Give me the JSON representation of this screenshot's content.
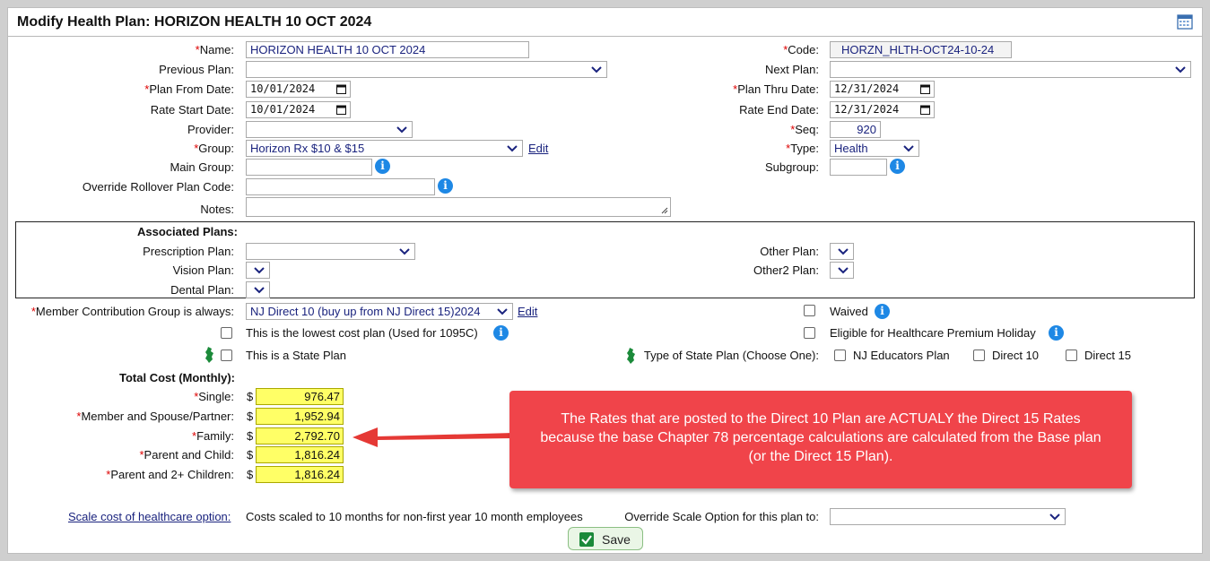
{
  "title": "Modify Health Plan: HORIZON HEALTH 10 OCT 2024",
  "form": {
    "name_label": "Name:",
    "name_value": "HORIZON HEALTH 10 OCT 2024",
    "code_label": "Code:",
    "code_value": "HORZN_HLTH-OCT24-10-24",
    "previous_plan_label": "Previous Plan:",
    "next_plan_label": "Next Plan:",
    "plan_from_label": "Plan From Date:",
    "plan_from_value": "10/01/2024",
    "plan_thru_label": "Plan Thru Date:",
    "plan_thru_value": "12/31/2024",
    "rate_start_label": "Rate Start Date:",
    "rate_start_value": "10/01/2024",
    "rate_end_label": "Rate End Date:",
    "rate_end_value": "12/31/2024",
    "provider_label": "Provider:",
    "seq_label": "Seq:",
    "seq_value": "920",
    "group_label": "Group:",
    "group_value": "Horizon Rx $10 & $15",
    "edit_label": "Edit",
    "type_label": "Type:",
    "type_value": "Health",
    "main_group_label": "Main Group:",
    "subgroup_label": "Subgroup:",
    "override_rollover_label": "Override Rollover Plan Code:",
    "notes_label": "Notes:"
  },
  "assoc": {
    "header": "Associated Plans:",
    "prescription_label": "Prescription Plan:",
    "vision_label": "Vision Plan:",
    "dental_label": "Dental Plan:",
    "other_label": "Other Plan:",
    "other2_label": "Other2 Plan:"
  },
  "contribution": {
    "label": "Member Contribution Group is always:",
    "value": "NJ Direct 10 (buy up from NJ Direct 15)2024",
    "edit_label": "Edit",
    "waived_label": "Waived",
    "lowest_cost_label": "This is the lowest cost plan (Used for 1095C)",
    "holiday_label": "Eligible for Healthcare Premium Holiday",
    "state_plan_label": "This is a State Plan",
    "state_type_label": "Type of State Plan (Choose One):",
    "nj_educators_label": "NJ Educators Plan",
    "direct10_label": "Direct 10",
    "direct15_label": "Direct 15"
  },
  "cost": {
    "header": "Total Cost (Monthly):",
    "currency": "$",
    "rows": [
      {
        "label": "Single:",
        "value": "976.47"
      },
      {
        "label": "Member and Spouse/Partner:",
        "value": "1,952.94"
      },
      {
        "label": "Family:",
        "value": "2,792.70"
      },
      {
        "label": "Parent and Child:",
        "value": "1,816.24"
      },
      {
        "label": "Parent and 2+ Children:",
        "value": "1,816.24"
      }
    ]
  },
  "callout": {
    "text": "The Rates that are posted to the Direct 10 Plan are ACTUALY the Direct 15 Rates because the base Chapter 78 percentage calculations are calculated from the Base plan (or the Direct 15 Plan)."
  },
  "scale": {
    "link_label": "Scale cost of healthcare option:",
    "description": "Costs scaled to 10 months for non-first year 10 month employees",
    "override_label": "Override Scale Option for this plan to:"
  },
  "save_label": "Save",
  "colors": {
    "accent_blue": "#1e88e5",
    "callout_red": "#f0444a",
    "cost_yellow": "#ffff66",
    "arrow_red": "#e53935"
  }
}
